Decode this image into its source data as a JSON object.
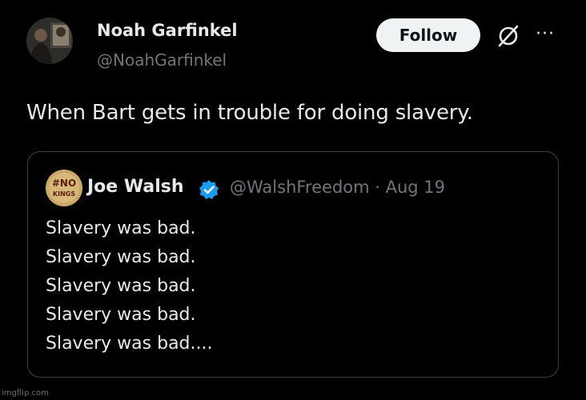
{
  "tweet": {
    "author_name": "Noah Garfinkel",
    "author_handle": "@NoahGarfinkel",
    "follow_label": "Follow",
    "more_label": "···",
    "text": "When Bart gets in trouble for doing slavery."
  },
  "quoted": {
    "avatar_text_top": "#NO",
    "avatar_text_bottom": "KINGS",
    "author_name": "Joe Walsh",
    "meta": "@WalshFreedom · Aug 19",
    "lines": [
      "Slavery was bad.",
      "Slavery was bad.",
      "Slavery was bad.",
      "Slavery was bad.",
      "Slavery was bad...."
    ]
  },
  "watermark": "imgflip.com",
  "colors": {
    "background": "#000000",
    "primary_text": "#e7e9ea",
    "secondary_text": "#71767b",
    "border": "#3e4144",
    "follow_bg": "#eff3f4",
    "verified": "#1d9bf0"
  },
  "icons": {
    "grok": "grok-icon",
    "more": "more-icon",
    "verified": "verified-badge-icon"
  }
}
